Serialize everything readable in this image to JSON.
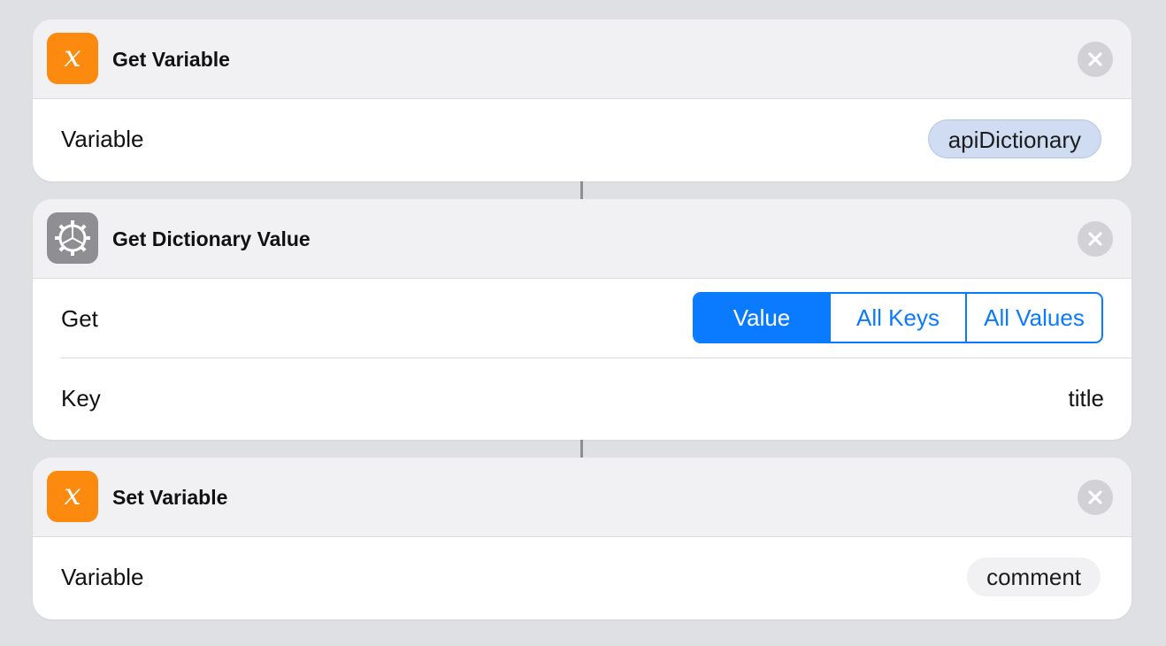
{
  "actions": [
    {
      "title": "Get Variable",
      "icon": "variable-x-icon",
      "rows": [
        {
          "label": "Variable",
          "value": "apiDictionary"
        }
      ]
    },
    {
      "title": "Get Dictionary Value",
      "icon": "gear-icon",
      "rows": [
        {
          "label": "Get",
          "options": [
            "Value",
            "All Keys",
            "All Values"
          ],
          "selected": "Value"
        },
        {
          "label": "Key",
          "value": "title"
        }
      ]
    },
    {
      "title": "Set Variable",
      "icon": "variable-x-icon",
      "rows": [
        {
          "label": "Variable",
          "value": "comment"
        }
      ]
    }
  ],
  "icon_glyph": "x",
  "colors": {
    "background": "#dfe0e4",
    "accent": "#0a7aff",
    "variable_icon": "#fc8a0e",
    "scripting_icon": "#8e8e93",
    "token_blue": "#cfdcf1"
  }
}
